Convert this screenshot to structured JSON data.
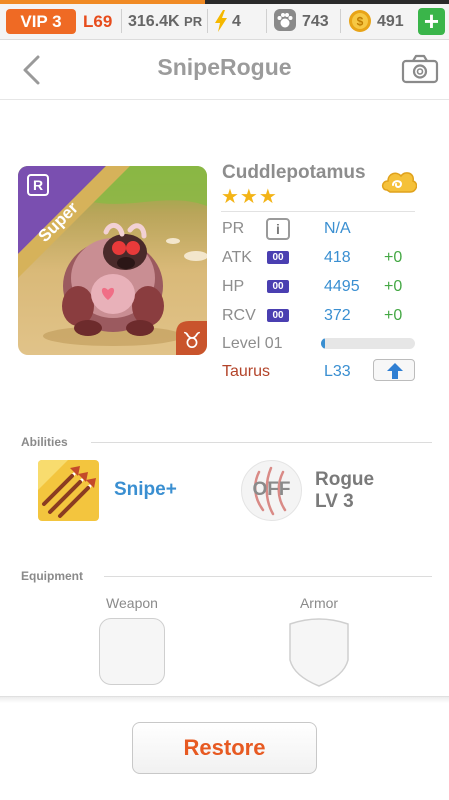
{
  "status_bar": {
    "vip_label": "VIP 3",
    "level": "L69",
    "power_value": "316.4K",
    "power_unit": "PR",
    "energy": "4",
    "paws": "743",
    "coins": "491",
    "add_label": "+",
    "icons": [
      "lightning-icon",
      "paw-icon",
      "coin-icon",
      "plus-icon"
    ],
    "colors": {
      "vip": "#ef6a24",
      "level": "#e74c1c",
      "add": "#3ab54a"
    }
  },
  "header": {
    "title": "SnipeRogue",
    "icons": [
      "back-arrow-icon",
      "camera-icon"
    ]
  },
  "monster": {
    "name": "Cuddlepotamus",
    "stars": "★★★",
    "rarity_badge": "R",
    "rarity_label": "Super",
    "zodiac_symbol": "♉",
    "element_icon": "cloud-element-icon",
    "stats": [
      {
        "label": "PR",
        "badge": "i",
        "value": "N/A",
        "bonus": ""
      },
      {
        "label": "ATK",
        "badge": "00",
        "value": "418",
        "bonus": "+0"
      },
      {
        "label": "HP",
        "badge": "00",
        "value": "4495",
        "bonus": "+0"
      },
      {
        "label": "RCV",
        "badge": "00",
        "value": "372",
        "bonus": "+0"
      }
    ],
    "level_label": "Level 01",
    "level_progress": 0.04,
    "sign_label": "Taurus",
    "sign_level": "L33",
    "upgrade_icon": "up-arrow-icon",
    "colors": {
      "value": "#3a8fd1",
      "bonus": "#45a845",
      "sign": "#b3442a",
      "badge": "#4a3fb1"
    }
  },
  "abilities": {
    "title": "Abilities",
    "skill_name": "Snipe+",
    "skill_icon": "arrows-skill-icon",
    "passive_state": "OFF",
    "passive_icon": "claw-marks-icon",
    "passive_name": "Rogue",
    "passive_level": "LV 3"
  },
  "equipment": {
    "title": "Equipment",
    "weapon_label": "Weapon",
    "armor_label": "Armor",
    "icons": [
      "weapon-slot-icon",
      "armor-shield-icon"
    ]
  },
  "footer": {
    "restore_label": "Restore",
    "restore_color": "#e75a22"
  }
}
